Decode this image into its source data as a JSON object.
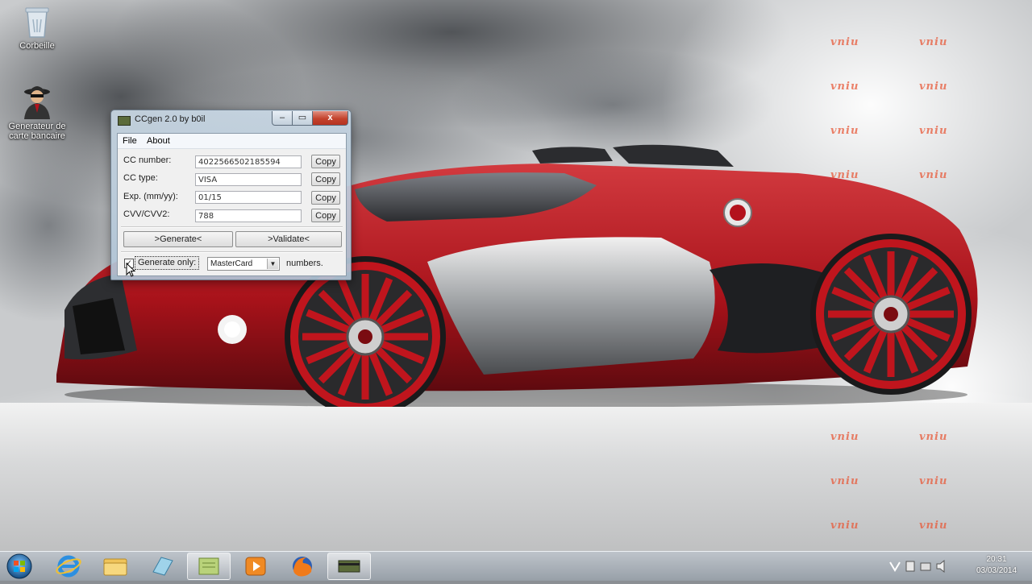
{
  "desktop": {
    "icons": [
      {
        "label": "Corbeille",
        "icon": "recycle-bin-icon"
      },
      {
        "label": "Generateur de carte bancaire",
        "icon": "spy-icon"
      }
    ],
    "watermark_text": "vniu"
  },
  "window": {
    "title": "CCgen 2.0 by b0il",
    "close_glyph": "x",
    "minimize_glyph": "–",
    "maximize_glyph": "▭",
    "menu": {
      "file": "File",
      "about": "About"
    },
    "fields": [
      {
        "label": "CC number:",
        "value": "4022566502185594"
      },
      {
        "label": "CC type:",
        "value": "VISA"
      },
      {
        "label": "Exp. (mm/yy):",
        "value": "01/15"
      },
      {
        "label": "CVV/CVV2:",
        "value": "788"
      }
    ],
    "copy_label": "Copy",
    "generate_label": ">Generate<",
    "validate_label": ">Validate<",
    "generate_only_label": "Generate only:",
    "generate_only_checked": true,
    "card_select_value": "MasterCard",
    "numbers_label": "numbers."
  },
  "taskbar": {
    "items": [
      "start-button",
      "internet-explorer-icon",
      "file-explorer-icon",
      "generic-app-icon",
      "notes-app-icon",
      "media-player-icon",
      "firefox-icon",
      "ccgen-app-icon"
    ],
    "clock_time": "20:31",
    "clock_date": "03/03/2014"
  },
  "colors": {
    "close_red": "#c3432d",
    "car_red": "#b3121c",
    "watermark": "#e85a3a"
  }
}
